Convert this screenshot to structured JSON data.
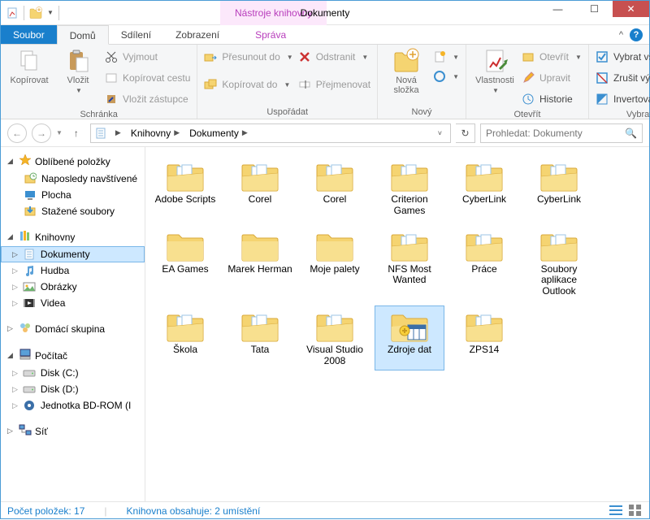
{
  "window": {
    "title": "Dokumenty",
    "contextual_tab": "Nástroje knihovny"
  },
  "tabs": {
    "file": "Soubor",
    "home": "Domů",
    "share": "Sdílení",
    "view": "Zobrazení",
    "manage": "Správa"
  },
  "ribbon": {
    "clipboard": {
      "label": "Schránka",
      "copy": "Kopírovat",
      "paste": "Vložit",
      "cut": "Vyjmout",
      "copy_path": "Kopírovat cestu",
      "paste_shortcut": "Vložit zástupce"
    },
    "organize": {
      "label": "Uspořádat",
      "move_to": "Přesunout do",
      "copy_to": "Kopírovat do",
      "delete": "Odstranit",
      "rename": "Přejmenovat"
    },
    "new": {
      "label": "Nový",
      "new_folder": "Nová\nsložka"
    },
    "open": {
      "label": "Otevřít",
      "properties": "Vlastnosti",
      "open": "Otevřít",
      "edit": "Upravit",
      "history": "Historie"
    },
    "select": {
      "label": "Vybrat",
      "select_all": "Vybrat vše",
      "select_none": "Zrušit výběr",
      "invert": "Invertovat výběr"
    }
  },
  "breadcrumb": {
    "root": "Knihovny",
    "current": "Dokumenty"
  },
  "search": {
    "placeholder": "Prohledat: Dokumenty"
  },
  "nav": {
    "favorites": {
      "label": "Oblíbené položky",
      "items": [
        "Naposledy navštívené",
        "Plocha",
        "Stažené soubory"
      ]
    },
    "libraries": {
      "label": "Knihovny",
      "items": [
        "Dokumenty",
        "Hudba",
        "Obrázky",
        "Videa"
      ],
      "selected": 0
    },
    "homegroup": "Domácí skupina",
    "computer": {
      "label": "Počítač",
      "items": [
        "Disk (C:)",
        "Disk (D:)",
        "Jednotka BD-ROM (I"
      ]
    },
    "network": "Síť"
  },
  "items": [
    {
      "name": "Adobe Scripts",
      "type": "folder-docs"
    },
    {
      "name": "Corel",
      "type": "folder-docs"
    },
    {
      "name": "Corel",
      "type": "folder-docs"
    },
    {
      "name": "Criterion Games",
      "type": "folder-docs"
    },
    {
      "name": "CyberLink",
      "type": "folder-docs"
    },
    {
      "name": "CyberLink",
      "type": "folder-docs"
    },
    {
      "name": "EA Games",
      "type": "folder"
    },
    {
      "name": "Marek Herman",
      "type": "folder"
    },
    {
      "name": "Moje palety",
      "type": "folder"
    },
    {
      "name": "NFS Most Wanted",
      "type": "folder-docs"
    },
    {
      "name": "Práce",
      "type": "folder-docs"
    },
    {
      "name": "Soubory aplikace Outlook",
      "type": "folder-docs"
    },
    {
      "name": "Škola",
      "type": "folder-docs"
    },
    {
      "name": "Tata",
      "type": "folder-docs"
    },
    {
      "name": "Visual Studio 2008",
      "type": "folder-docs"
    },
    {
      "name": "Zdroje dat",
      "type": "datasource",
      "selected": true
    },
    {
      "name": "ZPS14",
      "type": "folder-docs"
    }
  ],
  "status": {
    "count_label": "Počet položek: 17",
    "lib_label": "Knihovna obsahuje: 2 umístění"
  }
}
